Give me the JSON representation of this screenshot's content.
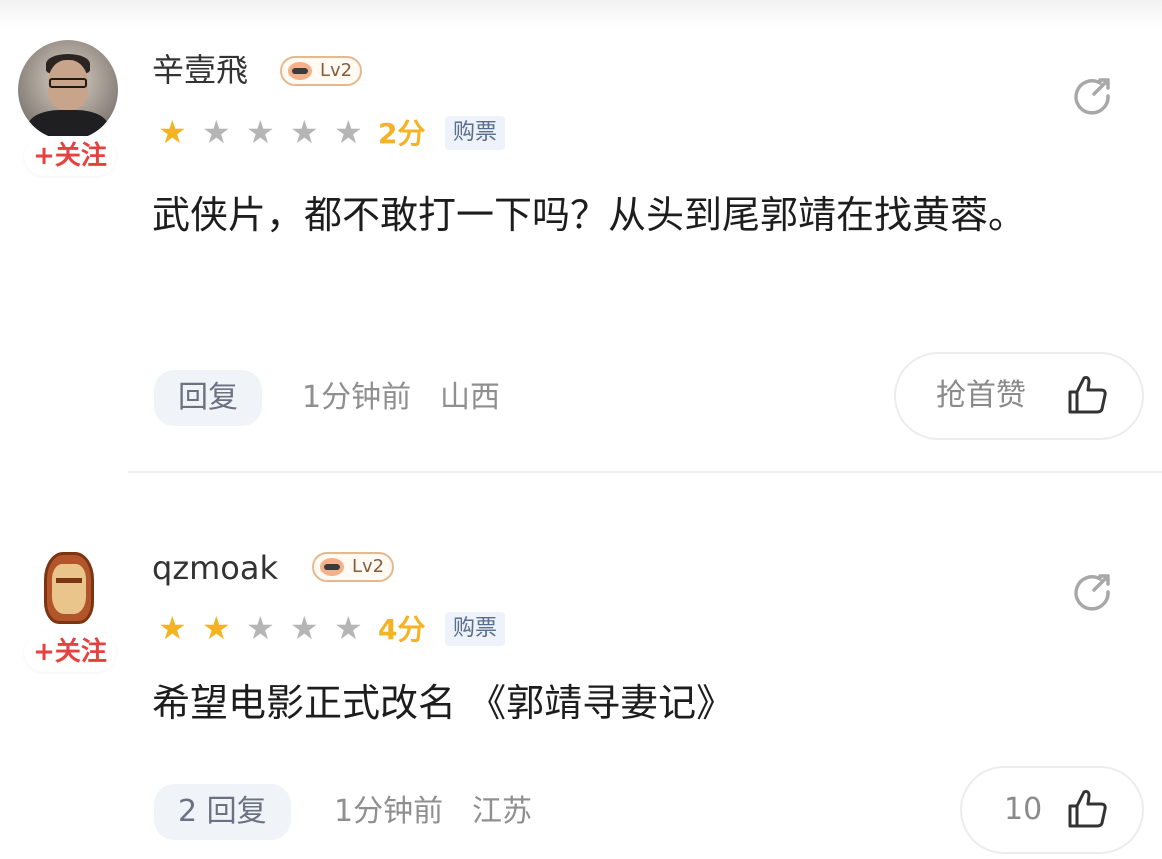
{
  "comments": [
    {
      "username": "辛壹飛",
      "level": "Lv2",
      "follow_label": "+关注",
      "rating_stars_filled": 1,
      "rating_stars_total": 5,
      "score_label": "2分",
      "tag": "购票",
      "content": "武侠片，都不敢打一下吗？从头到尾郭靖在找黄蓉。",
      "reply_label": "回复",
      "time": "1分钟前",
      "location": "山西",
      "like_label": "抢首赞"
    },
    {
      "username": "qzmoak",
      "level": "Lv2",
      "follow_label": "+关注",
      "rating_stars_filled": 2,
      "rating_stars_total": 5,
      "score_label": "4分",
      "tag": "购票",
      "content": "希望电影正式改名 《郭靖寻妻记》",
      "reply_label": "2 回复",
      "time": "1分钟前",
      "location": "江苏",
      "like_label": "10"
    }
  ],
  "icons": {
    "share": "share-icon",
    "thumb": "thumbs-up-icon",
    "star": "star-icon",
    "level_badge": "level-badge-icon"
  },
  "colors": {
    "follow": "#e8413d",
    "star_on": "#f5b323",
    "star_off": "#b5b5b5",
    "meta": "#8f8f8f",
    "tag_bg": "#eef3fb"
  }
}
